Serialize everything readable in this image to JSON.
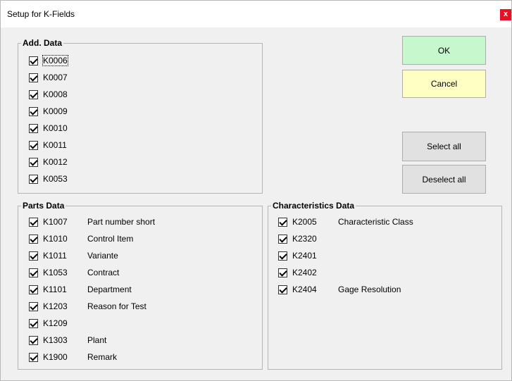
{
  "window": {
    "title": "Setup for K-Fields",
    "close": "x"
  },
  "add_data": {
    "legend": "Add. Data",
    "items": [
      {
        "code": "K0006",
        "checked": true
      },
      {
        "code": "K0007",
        "checked": true
      },
      {
        "code": "K0008",
        "checked": true
      },
      {
        "code": "K0009",
        "checked": true
      },
      {
        "code": "K0010",
        "checked": true
      },
      {
        "code": "K0011",
        "checked": true
      },
      {
        "code": "K0012",
        "checked": true
      },
      {
        "code": "K0053",
        "checked": true
      }
    ]
  },
  "parts_data": {
    "legend": "Parts Data",
    "items": [
      {
        "code": "K1007",
        "desc": "Part number short",
        "checked": true
      },
      {
        "code": "K1010",
        "desc": "Control Item",
        "checked": true
      },
      {
        "code": "K1011",
        "desc": "Variante",
        "checked": true
      },
      {
        "code": "K1053",
        "desc": "Contract",
        "checked": true
      },
      {
        "code": "K1101",
        "desc": "Department",
        "checked": true
      },
      {
        "code": "K1203",
        "desc": "Reason for Test",
        "checked": true
      },
      {
        "code": "K1209",
        "desc": "",
        "checked": true
      },
      {
        "code": "K1303",
        "desc": "Plant",
        "checked": true
      },
      {
        "code": "K1900",
        "desc": "Remark",
        "checked": true
      }
    ]
  },
  "characteristics_data": {
    "legend": "Characteristics Data",
    "items": [
      {
        "code": "K2005",
        "desc": "Characteristic Class",
        "checked": true
      },
      {
        "code": "K2320",
        "desc": "",
        "checked": true
      },
      {
        "code": "K2401",
        "desc": "",
        "checked": true
      },
      {
        "code": "K2402",
        "desc": "",
        "checked": true
      },
      {
        "code": "K2404",
        "desc": "Gage Resolution",
        "checked": true
      }
    ]
  },
  "buttons": {
    "ok": "OK",
    "cancel": "Cancel",
    "select_all": "Select all",
    "deselect_all": "Deselect all"
  },
  "colors": {
    "ok_bg": "#c6f7cd",
    "cancel_bg": "#ffffc4",
    "close_bg": "#e81123"
  }
}
